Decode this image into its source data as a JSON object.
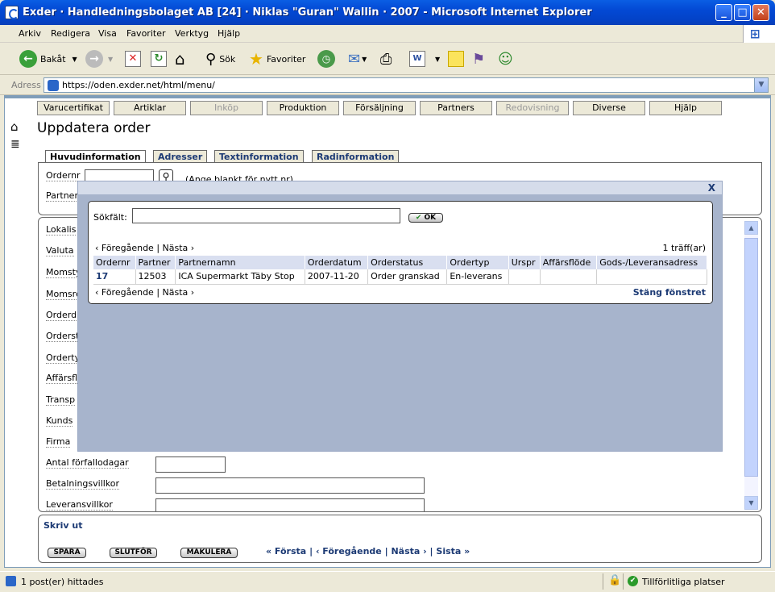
{
  "window": {
    "title": "Exder · Handledningsbolaget AB [24] · Niklas \"Guran\" Wallin · 2007 - Microsoft Internet Explorer"
  },
  "menubar": {
    "items": [
      "Arkiv",
      "Redigera",
      "Visa",
      "Favoriter",
      "Verktyg",
      "Hjälp"
    ]
  },
  "toolbar": {
    "back": "Bakåt",
    "search": "Sök",
    "favorites": "Favoriter"
  },
  "address": {
    "label": "Adress",
    "url": "https://oden.exder.net/html/menu/"
  },
  "nav": {
    "tabs": [
      "Varucertifikat",
      "Artiklar",
      "Inköp",
      "Produktion",
      "Försäljning",
      "Partners",
      "Redovisning",
      "Diverse",
      "Hjälp"
    ]
  },
  "page": {
    "title": "Uppdatera order"
  },
  "subtabs": [
    "Huvudinformation",
    "Adresser",
    "Textinformation",
    "Radinformation"
  ],
  "form": {
    "ordernr_label": "Ordernr",
    "ordernr_hint": "(Ange blankt för nytt nr)",
    "partner_label": "Partner",
    "fields": [
      "Lokalis",
      "Valuta",
      "Momsty",
      "Momsre",
      "Orderd",
      "Orderst",
      "Orderty",
      "Affärsfl",
      "Transp",
      "Kunds",
      "Firma"
    ],
    "antal_label": "Antal förfallodagar",
    "betalning_label": "Betalningsvillkor",
    "leverans_label": "Leveransvillkor"
  },
  "actions": {
    "print": "Skriv ut",
    "save": "SPARA",
    "finish": "SLUTFÖR",
    "cancel": "MAKULERA",
    "first": "« Första",
    "prev": "‹ Föregående",
    "next": "Nästa ›",
    "last": "Sista »",
    "sep": "|"
  },
  "dialog": {
    "close_x": "X",
    "search_label": "Sökfält:",
    "search_value": "",
    "ok": "OK",
    "prev": "‹ Föregående",
    "next": "Nästa ›",
    "sep": "|",
    "hits": "1 träff(ar)",
    "close_link": "Stäng fönstret",
    "columns": [
      "Ordernr",
      "Partner",
      "Partnernamn",
      "Orderdatum",
      "Orderstatus",
      "Ordertyp",
      "Urspr",
      "Affärsflöde",
      "Gods-/Leveransadress"
    ],
    "rows": [
      [
        "17",
        "12503",
        "ICA Supermarkt Täby Stop",
        "2007-11-20",
        "Order granskad",
        "En-leverans",
        "",
        "",
        ""
      ]
    ]
  },
  "status": {
    "left": "1 post(er) hittades",
    "zone": "Tillförlitliga platser"
  }
}
